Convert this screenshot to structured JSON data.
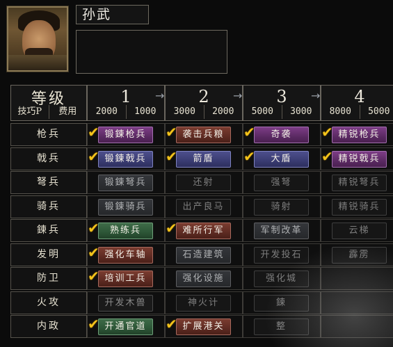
{
  "general": {
    "name": "孙武"
  },
  "header": {
    "title": "等级",
    "sub_left": "技巧P",
    "sub_right": "费用",
    "levels": [
      {
        "label": "1",
        "costs": [
          "2000",
          "1000"
        ]
      },
      {
        "label": "2",
        "costs": [
          "3000",
          "2000"
        ]
      },
      {
        "label": "3",
        "costs": [
          "5000",
          "3000"
        ]
      },
      {
        "label": "4",
        "costs": [
          "8000",
          "5000"
        ]
      }
    ]
  },
  "rows": [
    {
      "label": "枪兵",
      "skills": [
        {
          "text": "锻鍊枪兵",
          "style": "purple",
          "checked": true
        },
        {
          "text": "袭击兵粮",
          "style": "red",
          "checked": true
        },
        {
          "text": "奇袭",
          "style": "purple",
          "checked": true
        },
        {
          "text": "精锐枪兵",
          "style": "purple",
          "checked": true
        }
      ]
    },
    {
      "label": "戟兵",
      "skills": [
        {
          "text": "锻鍊戟兵",
          "style": "blue",
          "checked": true
        },
        {
          "text": "箭盾",
          "style": "blue",
          "checked": true
        },
        {
          "text": "大盾",
          "style": "blue",
          "checked": true
        },
        {
          "text": "精锐戟兵",
          "style": "purple",
          "checked": true
        }
      ]
    },
    {
      "label": "弩兵",
      "skills": [
        {
          "text": "锻鍊弩兵",
          "style": "grey",
          "checked": false
        },
        {
          "text": "还射",
          "style": "locked",
          "checked": false
        },
        {
          "text": "强弩",
          "style": "locked",
          "checked": false
        },
        {
          "text": "精锐弩兵",
          "style": "locked",
          "checked": false
        }
      ]
    },
    {
      "label": "骑兵",
      "skills": [
        {
          "text": "锻鍊骑兵",
          "style": "grey",
          "checked": false
        },
        {
          "text": "出产良马",
          "style": "locked",
          "checked": false
        },
        {
          "text": "骑射",
          "style": "locked",
          "checked": false
        },
        {
          "text": "精锐骑兵",
          "style": "locked",
          "checked": false
        }
      ]
    },
    {
      "label": "鍊兵",
      "skills": [
        {
          "text": "熟练兵",
          "style": "green",
          "checked": true
        },
        {
          "text": "难所行军",
          "style": "red",
          "checked": true
        },
        {
          "text": "军制改革",
          "style": "grey",
          "checked": false
        },
        {
          "text": "云梯",
          "style": "locked",
          "checked": false
        }
      ]
    },
    {
      "label": "发明",
      "skills": [
        {
          "text": "强化车轴",
          "style": "red",
          "checked": true
        },
        {
          "text": "石造建筑",
          "style": "grey",
          "checked": false
        },
        {
          "text": "开发投石",
          "style": "locked",
          "checked": false
        },
        {
          "text": "霹雳",
          "style": "locked",
          "checked": false
        }
      ]
    },
    {
      "label": "防卫",
      "skills": [
        {
          "text": "培训工兵",
          "style": "red",
          "checked": true
        },
        {
          "text": "强化设施",
          "style": "grey",
          "checked": false
        },
        {
          "text": "强化城",
          "style": "locked",
          "checked": false
        },
        {
          "text": "",
          "style": "none",
          "checked": false
        }
      ]
    },
    {
      "label": "火攻",
      "skills": [
        {
          "text": "开发木兽",
          "style": "dark",
          "checked": false
        },
        {
          "text": "神火计",
          "style": "locked",
          "checked": false
        },
        {
          "text": "鍊",
          "style": "locked",
          "checked": false
        },
        {
          "text": "",
          "style": "none",
          "checked": false
        }
      ]
    },
    {
      "label": "内政",
      "skills": [
        {
          "text": "开通官道",
          "style": "green",
          "checked": true
        },
        {
          "text": "扩展港关",
          "style": "red",
          "checked": true
        },
        {
          "text": "整",
          "style": "locked",
          "checked": false
        },
        {
          "text": "",
          "style": "none",
          "checked": false
        }
      ]
    }
  ],
  "icons": {
    "check": "checkmark-icon",
    "arrow": "arrow-right-icon"
  },
  "colors": {
    "check": "#f2c21b",
    "background": "#0b0b0b"
  }
}
